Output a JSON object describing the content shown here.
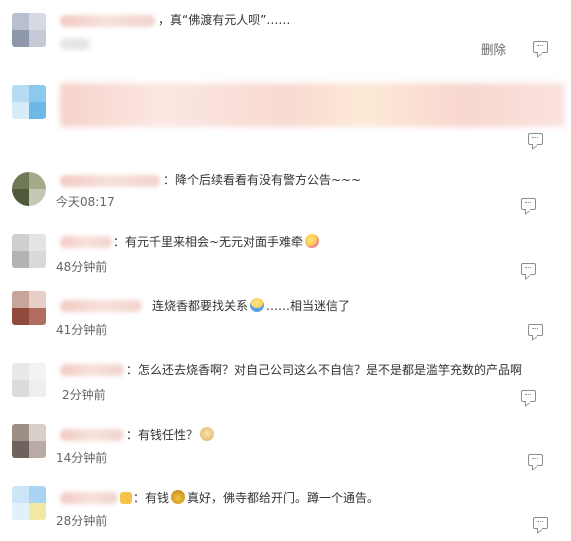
{
  "comments": [
    {
      "text": "，真“佛渡有元人呗”……",
      "time": "",
      "action": "删除",
      "reply_icon": "reply-icon"
    },
    {
      "text": "",
      "time": "",
      "reply_icon": "reply-icon"
    },
    {
      "text": "：降个后续看看有没有警方公告~~~",
      "time": "今天08:17",
      "reply_icon": "reply-icon"
    },
    {
      "text": "：有元千里来相会~无元对面手难牵",
      "time": "48分钟前",
      "emoji": "smirk-emoji",
      "reply_icon": "reply-icon"
    },
    {
      "text": "连烧香都要找关系",
      "text_after": "……相当迷信了",
      "time": "41分钟前",
      "emoji": "facepalm-emoji",
      "reply_icon": "reply-icon"
    },
    {
      "text": "：怎么还去烧香啊？对自己公司这么不自信？是不是都是滥竽充数的产品啊",
      "time": "2分钟前",
      "reply_icon": "reply-icon"
    },
    {
      "text": "：有钱任性？",
      "time": "14分钟前",
      "emoji": "doge-emoji",
      "reply_icon": "reply-icon"
    },
    {
      "text": "：有钱",
      "text_after": "真好，佛寺都给开门。蹲一个通告。",
      "time": "28分钟前",
      "emoji": "money-bag-emoji",
      "reply_icon": "reply-icon"
    }
  ]
}
